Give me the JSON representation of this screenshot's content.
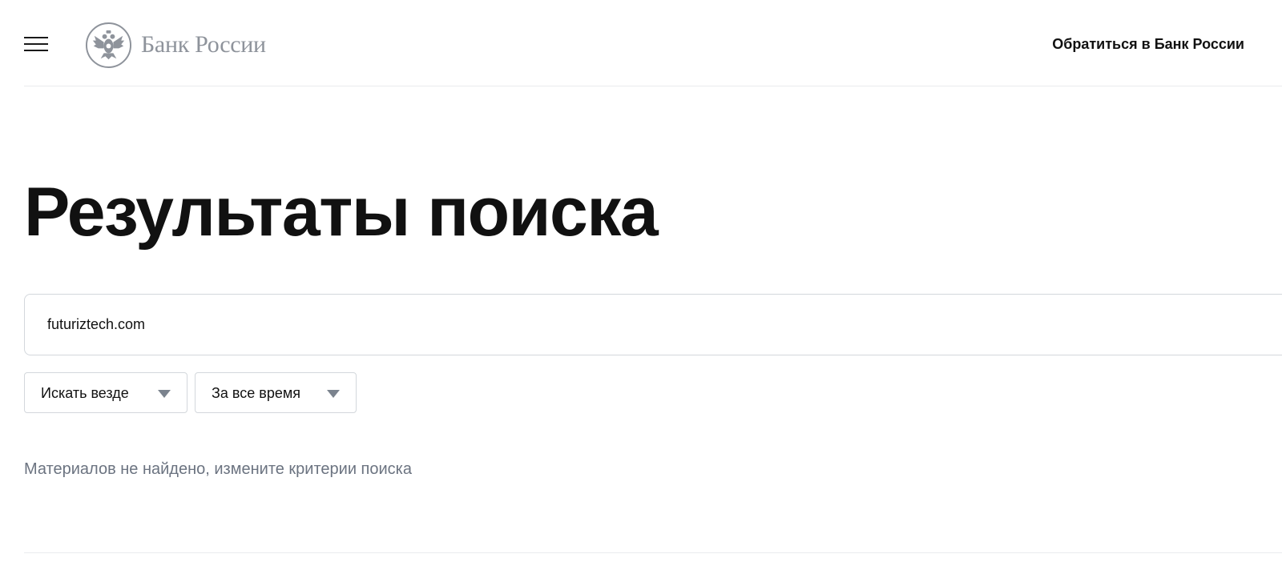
{
  "header": {
    "logo_text": "Банк России",
    "contact_link": "Обратиться в Банк России"
  },
  "main": {
    "title": "Результаты поиска",
    "search": {
      "value": "futuriztech.com"
    },
    "filters": {
      "where": {
        "selected": "Искать везде"
      },
      "when": {
        "selected": "За все время"
      }
    },
    "empty_message": "Материалов не найдено, измените критерии поиска"
  },
  "icons": {
    "menu": "hamburger-menu-icon",
    "logo": "double-headed-eagle-emblem",
    "dropdown": "triangle-down-icon"
  },
  "colors": {
    "text": "#111111",
    "muted_text": "#6b7380",
    "logo_gray": "#8e939b",
    "border": "#d3d7dc",
    "caret": "#7b838e"
  }
}
